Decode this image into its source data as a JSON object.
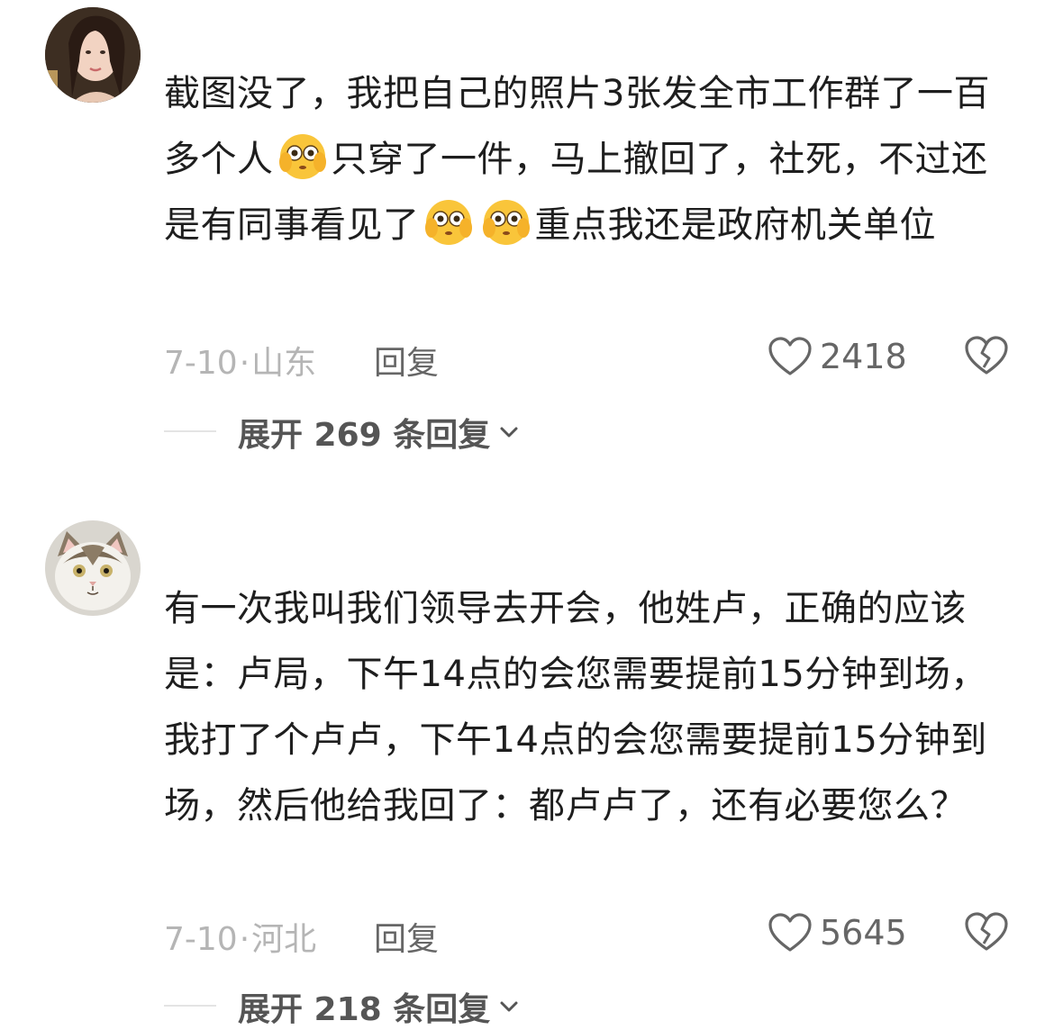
{
  "comments": [
    {
      "avatar_icon": "user-avatar-woman",
      "text_parts": [
        "截图没了，我把自己的照片3张发全市工作群了一百多个人",
        "只穿了一件，马上撤回了，社死，不过还是有同事看见了",
        "",
        "重点我还是政府机关单位"
      ],
      "emoji_icon": "flushed-face-emoji",
      "date": "7-10",
      "separator": "·",
      "location": "山东",
      "reply_label": "回复",
      "like_count": "2418",
      "expand_label": "展开 269 条回复"
    },
    {
      "avatar_icon": "user-avatar-cat",
      "text": "有一次我叫我们领导去开会，他姓卢，正确的应该是：卢局，下午14点的会您需要提前15分钟到场，我打了个卢卢，下午14点的会您需要提前15分钟到场，然后他给我回了：都卢卢了，还有必要您么？",
      "date": "7-10",
      "separator": "·",
      "location": "河北",
      "reply_label": "回复",
      "like_count": "5645",
      "expand_label": "展开 218 条回复"
    }
  ],
  "colors": {
    "text": "#1e1e1e",
    "meta": "#b5b5b5",
    "action": "#666666",
    "expand": "#555555",
    "emoji_face": "#f9c53a"
  }
}
